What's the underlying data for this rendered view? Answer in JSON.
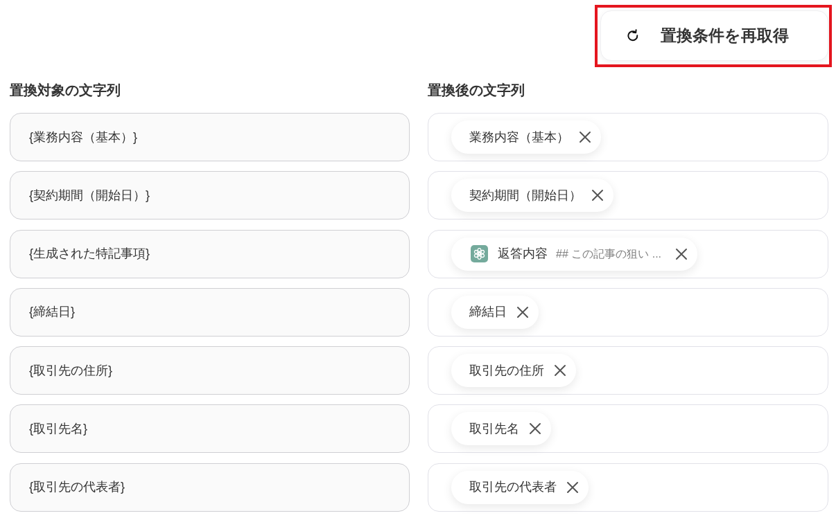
{
  "refresh_button": {
    "label": "置換条件を再取得",
    "highlighted": true
  },
  "headings": [
    "置換対象の文字列",
    "置換後の文字列"
  ],
  "rows": [
    {
      "target": "{業務内容（基本）}",
      "replacement": [
        {
          "kind": "variable",
          "label": "業務内容（基本）"
        }
      ]
    },
    {
      "target": "{契約期間（開始日）}",
      "replacement": [
        {
          "kind": "variable",
          "label": "契約期間（開始日）"
        }
      ]
    },
    {
      "target": "{生成された特記事項}",
      "replacement": [
        {
          "kind": "ai_output",
          "label": "返答内容",
          "preview": "## この記事の狙い ..."
        }
      ]
    },
    {
      "target": "{締結日}",
      "replacement": [
        {
          "kind": "variable",
          "label": "締結日"
        }
      ]
    },
    {
      "target": "{取引先の住所}",
      "replacement": [
        {
          "kind": "variable",
          "label": "取引先の住所"
        }
      ]
    },
    {
      "target": "{取引先名}",
      "replacement": [
        {
          "kind": "variable",
          "label": "取引先名"
        }
      ]
    },
    {
      "target": "{取引先の代表者}",
      "replacement": [
        {
          "kind": "variable",
          "label": "取引先の代表者"
        }
      ]
    }
  ]
}
